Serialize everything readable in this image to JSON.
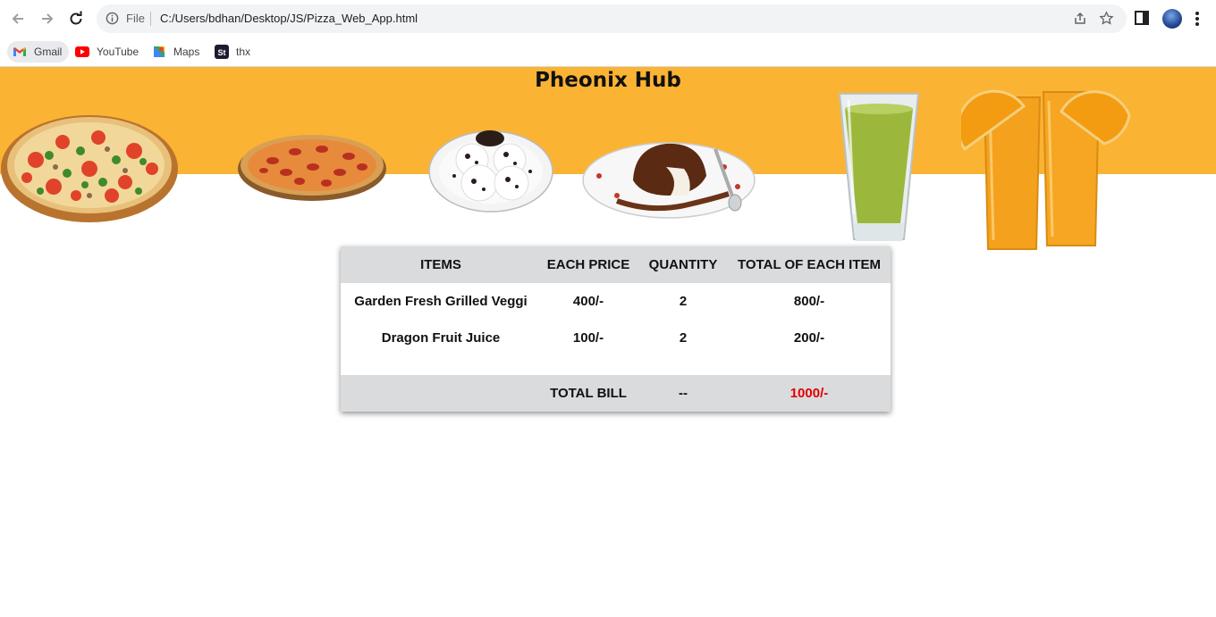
{
  "browser": {
    "file_label": "File",
    "url": "C:/Users/bdhan/Desktop/JS/Pizza_Web_App.html",
    "bookmarks": [
      {
        "label": "Gmail",
        "icon": "gmail-icon"
      },
      {
        "label": "YouTube",
        "icon": "youtube-icon"
      },
      {
        "label": "Maps",
        "icon": "maps-icon"
      },
      {
        "label": "thx",
        "icon": "st-icon"
      }
    ]
  },
  "page": {
    "title": "Pheonix Hub",
    "banner_color": "#fbb334"
  },
  "bill": {
    "headers": [
      "ITEMS",
      "EACH PRICE",
      "QUANTITY",
      "TOTAL OF EACH ITEM"
    ],
    "rows": [
      {
        "item": "Garden Fresh Grilled Veggi",
        "price": "400/-",
        "qty": "2",
        "total": "800/-"
      },
      {
        "item": "Dragon Fruit Juice",
        "price": "100/-",
        "qty": "2",
        "total": "200/-"
      }
    ],
    "footer": {
      "label": "TOTAL BILL",
      "qty": "--",
      "amount": "1000/-",
      "amount_color": "#e00000"
    }
  }
}
